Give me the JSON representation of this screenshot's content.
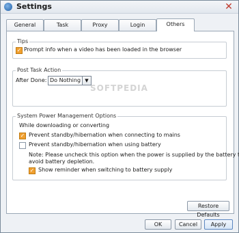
{
  "window": {
    "title": "Settings"
  },
  "tabs": [
    {
      "label": "General"
    },
    {
      "label": "Task"
    },
    {
      "label": "Proxy"
    },
    {
      "label": "Login"
    },
    {
      "label": "Others"
    }
  ],
  "tips": {
    "group_title": "Tips",
    "prompt_info_label": "Prompt info when a video has been loaded in the browser",
    "prompt_info_checked": true
  },
  "post_task": {
    "group_title": "Post Task Action",
    "after_done_label": "After Done:",
    "after_done_value": "Do Nothing"
  },
  "power": {
    "group_title": "System Power Management Options",
    "while_label": "While downloading or converting",
    "prevent_mains_label": "Prevent standby/hibernation when connecting to mains",
    "prevent_mains_checked": true,
    "prevent_battery_label": "Prevent standby/hibernation when using battery",
    "prevent_battery_checked": false,
    "note_line1": "Note: Please uncheck this option when the power is supplied by the battery to",
    "note_line2": "avoid battery depletion.",
    "reminder_label": "Show reminder when switching to battery supply",
    "reminder_checked": true
  },
  "buttons": {
    "restore": "Restore Defaults",
    "ok": "OK",
    "cancel": "Cancel",
    "apply": "Apply"
  },
  "watermark": "SOFTPEDIA"
}
